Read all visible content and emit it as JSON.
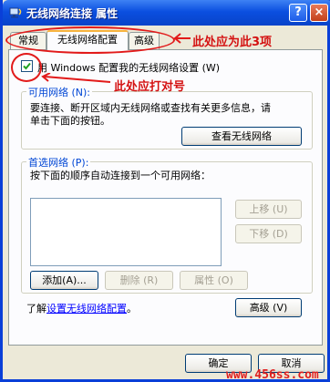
{
  "window": {
    "title": "无线网络连接  属性",
    "help_label": "?",
    "close_label": "×"
  },
  "tabs": [
    {
      "label": "常规"
    },
    {
      "label": "无线网络配置"
    },
    {
      "label": "高级"
    }
  ],
  "checkbox": {
    "label": "用 Windows 配置我的无线网络设置 (W)",
    "checked": true
  },
  "available": {
    "heading": "可用网络 (N):",
    "description_line1": "要连接、断开区域内无线网络或查找有关更多信息，请",
    "description_line2": "单击下面的按钮。",
    "view_button": "查看无线网络"
  },
  "preferred": {
    "heading": "首选网络 (P):",
    "description": "按下面的顺序自动连接到一个可用网络：",
    "move_up": "上移 (U)",
    "move_down": "下移 (D)",
    "add": "添加(A)...",
    "remove": "删除 (R)",
    "properties": "属性 (O)"
  },
  "footer": {
    "learn_prefix": "了解",
    "learn_link": "设置无线网络配置",
    "learn_suffix": "。",
    "advanced_button": "高级 (V)"
  },
  "dialog_buttons": {
    "ok": "确定",
    "cancel": "取消"
  },
  "annotations": {
    "tabs_note": "此处应为此3项",
    "checkbox_note": "此处应打对号",
    "watermark": "www.456ss.com"
  },
  "colors": {
    "annotation_red": "#e21a1a",
    "title_blue": "#0b4fe0",
    "group_heading_blue": "#0046d5"
  }
}
